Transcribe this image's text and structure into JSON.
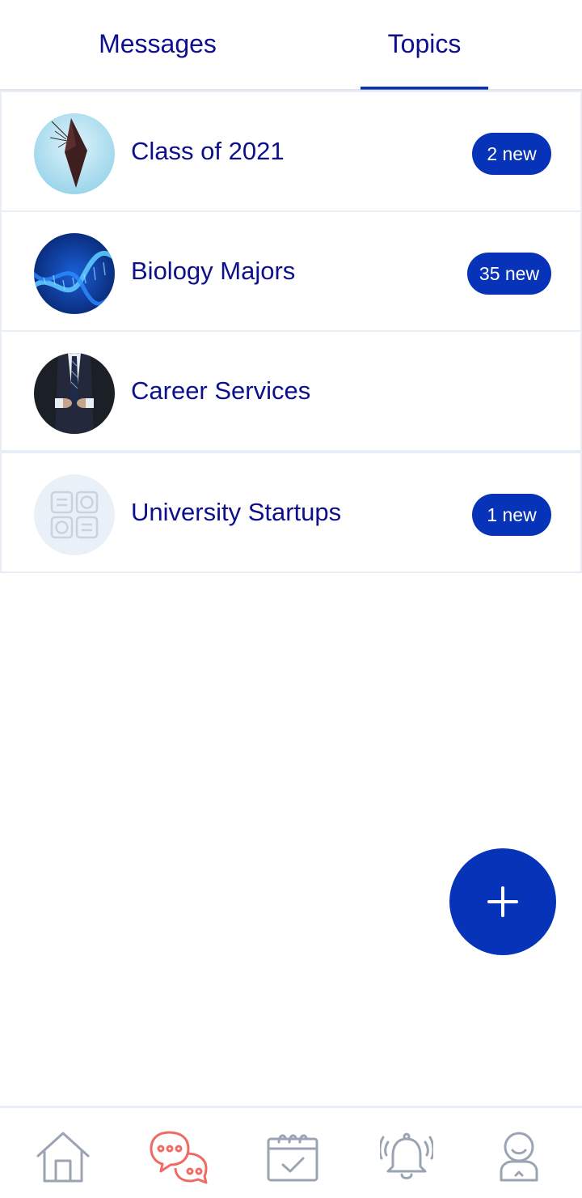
{
  "tabs": {
    "messages_label": "Messages",
    "topics_label": "Topics",
    "active": "Topics"
  },
  "topics": [
    {
      "name": "Class of 2021",
      "badge": "2 new",
      "avatar": "graduation-cap-photo"
    },
    {
      "name": "Biology Majors",
      "badge": "35 new",
      "avatar": "dna-helix-photo"
    },
    {
      "name": "Career Services",
      "badge": "",
      "avatar": "business-suit-photo"
    },
    {
      "name": "University Startups",
      "badge": "1 new",
      "avatar": "placeholder-grid-icon"
    }
  ],
  "fab": {
    "icon": "plus-icon"
  },
  "bottom_nav": {
    "items": [
      "home-icon",
      "chat-bubbles-icon",
      "calendar-check-icon",
      "bell-icon",
      "profile-icon"
    ],
    "active": "chat-bubbles-icon"
  },
  "colors": {
    "brand_blue": "#0733b8",
    "text_navy": "#0d0f8c",
    "active_nav": "#f06b63",
    "inactive_nav": "#9aa4b2"
  }
}
